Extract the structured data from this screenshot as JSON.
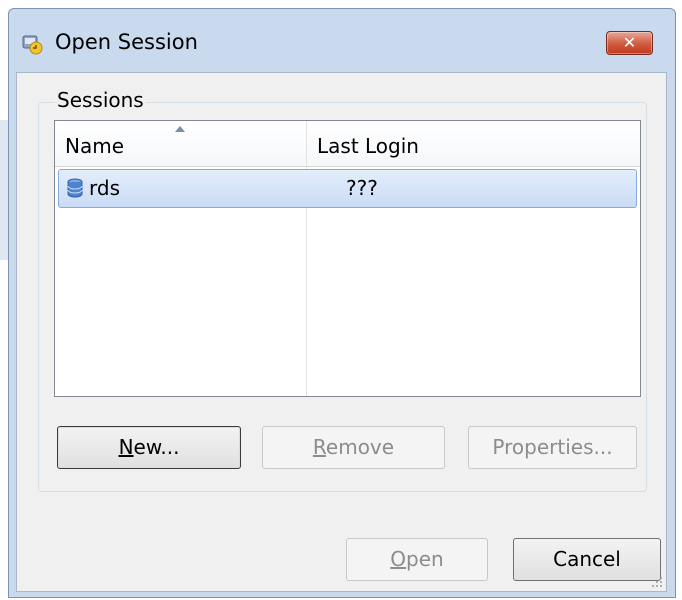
{
  "dialog": {
    "title": "Open Session"
  },
  "sessions_group": {
    "label": "Sessions"
  },
  "list": {
    "columns": [
      "Name",
      "Last Login"
    ],
    "rows": [
      {
        "name": "rds",
        "last_login": "???"
      }
    ]
  },
  "buttons": {
    "new": {
      "mnemonic": "N",
      "rest": "ew..."
    },
    "remove": {
      "mnemonic": "R",
      "rest": "emove"
    },
    "properties": "Properties...",
    "open": {
      "mnemonic": "O",
      "rest": "pen"
    },
    "cancel": "Cancel"
  },
  "colors": {
    "dialog_frame": "#c9daee",
    "client_bg": "#f0f0f0",
    "selection": "#c9dcf6",
    "close_button": "#d05a3f"
  },
  "icons": [
    "app-session-icon",
    "close-icon",
    "database-icon",
    "sort-ascending-icon",
    "resize-grip-icon"
  ]
}
